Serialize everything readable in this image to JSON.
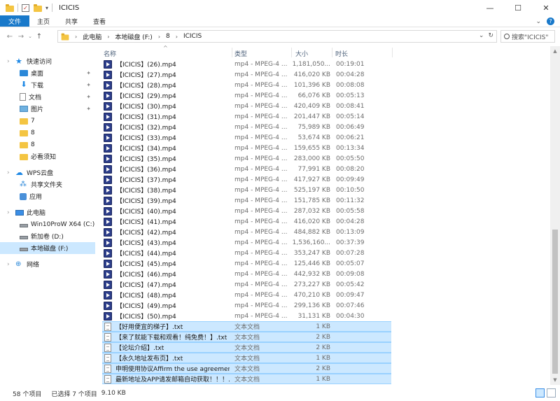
{
  "window": {
    "title": "ICICIS",
    "controls": {
      "minimize": "—",
      "maximize": "☐",
      "close": "✕"
    }
  },
  "ribbon": {
    "tabs": [
      "文件",
      "主页",
      "共享",
      "查看"
    ],
    "expand_icon": "chevron-down-icon",
    "help_icon": "help-icon"
  },
  "address": {
    "crumbs": [
      "此电脑",
      "本地磁盘 (F:)",
      "8",
      "ICICIS"
    ],
    "search_placeholder": "搜索\"ICICIS\""
  },
  "nav": {
    "items": [
      {
        "label": "快速访问",
        "icon": "star-icon",
        "pinned": false
      },
      {
        "label": "桌面",
        "icon": "desktop-icon",
        "pinned": true
      },
      {
        "label": "下载",
        "icon": "download-icon",
        "pinned": true
      },
      {
        "label": "文档",
        "icon": "document-icon",
        "pinned": true
      },
      {
        "label": "图片",
        "icon": "picture-icon",
        "pinned": true
      },
      {
        "label": "7",
        "icon": "folder-icon",
        "pinned": false
      },
      {
        "label": "8",
        "icon": "folder-icon",
        "pinned": false
      },
      {
        "label": "8",
        "icon": "folder-icon",
        "pinned": false
      },
      {
        "label": "必看须知",
        "icon": "folder-icon",
        "pinned": false
      },
      {
        "label": "WPS云盘",
        "icon": "cloud-icon",
        "pinned": false
      },
      {
        "label": "共享文件夹",
        "icon": "share-icon",
        "pinned": false
      },
      {
        "label": "应用",
        "icon": "app-icon",
        "pinned": false
      },
      {
        "label": "此电脑",
        "icon": "computer-icon",
        "pinned": false
      },
      {
        "label": "Win10ProW X64 (C:)",
        "icon": "drive-icon",
        "pinned": false
      },
      {
        "label": "新加卷 (D:)",
        "icon": "drive-icon",
        "pinned": false
      },
      {
        "label": "本地磁盘 (F:)",
        "icon": "drive-icon",
        "pinned": false,
        "selected": true
      },
      {
        "label": "网络",
        "icon": "network-icon",
        "pinned": false
      }
    ]
  },
  "columns": {
    "name": "名称",
    "type": "类型",
    "size": "大小",
    "duration": "时长"
  },
  "files": [
    {
      "name": "【ICICIS】(26).mp4",
      "type": "mp4 - MPEG-4 ...",
      "size": "1,181,050...",
      "duration": "00:19:01",
      "kind": "video",
      "selected": false
    },
    {
      "name": "【ICICIS】(27).mp4",
      "type": "mp4 - MPEG-4 ...",
      "size": "416,020 KB",
      "duration": "00:04:28",
      "kind": "video",
      "selected": false
    },
    {
      "name": "【ICICIS】(28).mp4",
      "type": "mp4 - MPEG-4 ...",
      "size": "101,396 KB",
      "duration": "00:08:08",
      "kind": "video",
      "selected": false
    },
    {
      "name": "【ICICIS】(29).mp4",
      "type": "mp4 - MPEG-4 ...",
      "size": "66,076 KB",
      "duration": "00:05:13",
      "kind": "video",
      "selected": false
    },
    {
      "name": "【ICICIS】(30).mp4",
      "type": "mp4 - MPEG-4 ...",
      "size": "420,409 KB",
      "duration": "00:08:41",
      "kind": "video",
      "selected": false
    },
    {
      "name": "【ICICIS】(31).mp4",
      "type": "mp4 - MPEG-4 ...",
      "size": "201,447 KB",
      "duration": "00:05:14",
      "kind": "video",
      "selected": false
    },
    {
      "name": "【ICICIS】(32).mp4",
      "type": "mp4 - MPEG-4 ...",
      "size": "75,989 KB",
      "duration": "00:06:49",
      "kind": "video",
      "selected": false
    },
    {
      "name": "【ICICIS】(33).mp4",
      "type": "mp4 - MPEG-4 ...",
      "size": "53,674 KB",
      "duration": "00:06:21",
      "kind": "video",
      "selected": false
    },
    {
      "name": "【ICICIS】(34).mp4",
      "type": "mp4 - MPEG-4 ...",
      "size": "159,655 KB",
      "duration": "00:13:34",
      "kind": "video",
      "selected": false
    },
    {
      "name": "【ICICIS】(35).mp4",
      "type": "mp4 - MPEG-4 ...",
      "size": "283,000 KB",
      "duration": "00:05:50",
      "kind": "video",
      "selected": false
    },
    {
      "name": "【ICICIS】(36).mp4",
      "type": "mp4 - MPEG-4 ...",
      "size": "77,991 KB",
      "duration": "00:08:20",
      "kind": "video",
      "selected": false
    },
    {
      "name": "【ICICIS】(37).mp4",
      "type": "mp4 - MPEG-4 ...",
      "size": "417,927 KB",
      "duration": "00:09:49",
      "kind": "video",
      "selected": false
    },
    {
      "name": "【ICICIS】(38).mp4",
      "type": "mp4 - MPEG-4 ...",
      "size": "525,197 KB",
      "duration": "00:10:50",
      "kind": "video",
      "selected": false
    },
    {
      "name": "【ICICIS】(39).mp4",
      "type": "mp4 - MPEG-4 ...",
      "size": "151,785 KB",
      "duration": "00:11:32",
      "kind": "video",
      "selected": false
    },
    {
      "name": "【ICICIS】(40).mp4",
      "type": "mp4 - MPEG-4 ...",
      "size": "287,032 KB",
      "duration": "00:05:58",
      "kind": "video",
      "selected": false
    },
    {
      "name": "【ICICIS】(41).mp4",
      "type": "mp4 - MPEG-4 ...",
      "size": "416,020 KB",
      "duration": "00:04:28",
      "kind": "video",
      "selected": false
    },
    {
      "name": "【ICICIS】(42).mp4",
      "type": "mp4 - MPEG-4 ...",
      "size": "484,882 KB",
      "duration": "00:13:09",
      "kind": "video",
      "selected": false
    },
    {
      "name": "【ICICIS】(43).mp4",
      "type": "mp4 - MPEG-4 ...",
      "size": "1,536,160...",
      "duration": "00:37:39",
      "kind": "video",
      "selected": false
    },
    {
      "name": "【ICICIS】(44).mp4",
      "type": "mp4 - MPEG-4 ...",
      "size": "353,247 KB",
      "duration": "00:07:28",
      "kind": "video",
      "selected": false
    },
    {
      "name": "【ICICIS】(45).mp4",
      "type": "mp4 - MPEG-4 ...",
      "size": "125,446 KB",
      "duration": "00:05:07",
      "kind": "video",
      "selected": false
    },
    {
      "name": "【ICICIS】(46).mp4",
      "type": "mp4 - MPEG-4 ...",
      "size": "442,932 KB",
      "duration": "00:09:08",
      "kind": "video",
      "selected": false
    },
    {
      "name": "【ICICIS】(47).mp4",
      "type": "mp4 - MPEG-4 ...",
      "size": "273,227 KB",
      "duration": "00:05:42",
      "kind": "video",
      "selected": false
    },
    {
      "name": "【ICICIS】(48).mp4",
      "type": "mp4 - MPEG-4 ...",
      "size": "470,210 KB",
      "duration": "00:09:47",
      "kind": "video",
      "selected": false
    },
    {
      "name": "【ICICIS】(49).mp4",
      "type": "mp4 - MPEG-4 ...",
      "size": "299,136 KB",
      "duration": "00:07:46",
      "kind": "video",
      "selected": false
    },
    {
      "name": "【ICICIS】(50).mp4",
      "type": "mp4 - MPEG-4 ...",
      "size": "31,131 KB",
      "duration": "00:04:30",
      "kind": "video",
      "selected": false
    },
    {
      "name": "【好用便宜的梯子】.txt",
      "type": "文本文档",
      "size": "1 KB",
      "duration": "",
      "kind": "text",
      "selected": true
    },
    {
      "name": "【来了就能下载和观看！纯免费！】.txt",
      "type": "文本文档",
      "size": "2 KB",
      "duration": "",
      "kind": "text",
      "selected": true
    },
    {
      "name": "【论坛介绍】.txt",
      "type": "文本文档",
      "size": "2 KB",
      "duration": "",
      "kind": "text",
      "selected": true
    },
    {
      "name": "【永久地址发布页】.txt",
      "type": "文本文档",
      "size": "1 KB",
      "duration": "",
      "kind": "text",
      "selected": true
    },
    {
      "name": "申明使用协议Affirm the use agreemen...",
      "type": "文本文档",
      "size": "2 KB",
      "duration": "",
      "kind": "text",
      "selected": true
    },
    {
      "name": "最新地址及APP请发邮箱自动获取！！！...",
      "type": "文本文档",
      "size": "1 KB",
      "duration": "",
      "kind": "text",
      "selected": true
    }
  ],
  "status": {
    "count": "58 个项目",
    "selected": "已选择 7 个项目",
    "size": "9.10 KB"
  }
}
